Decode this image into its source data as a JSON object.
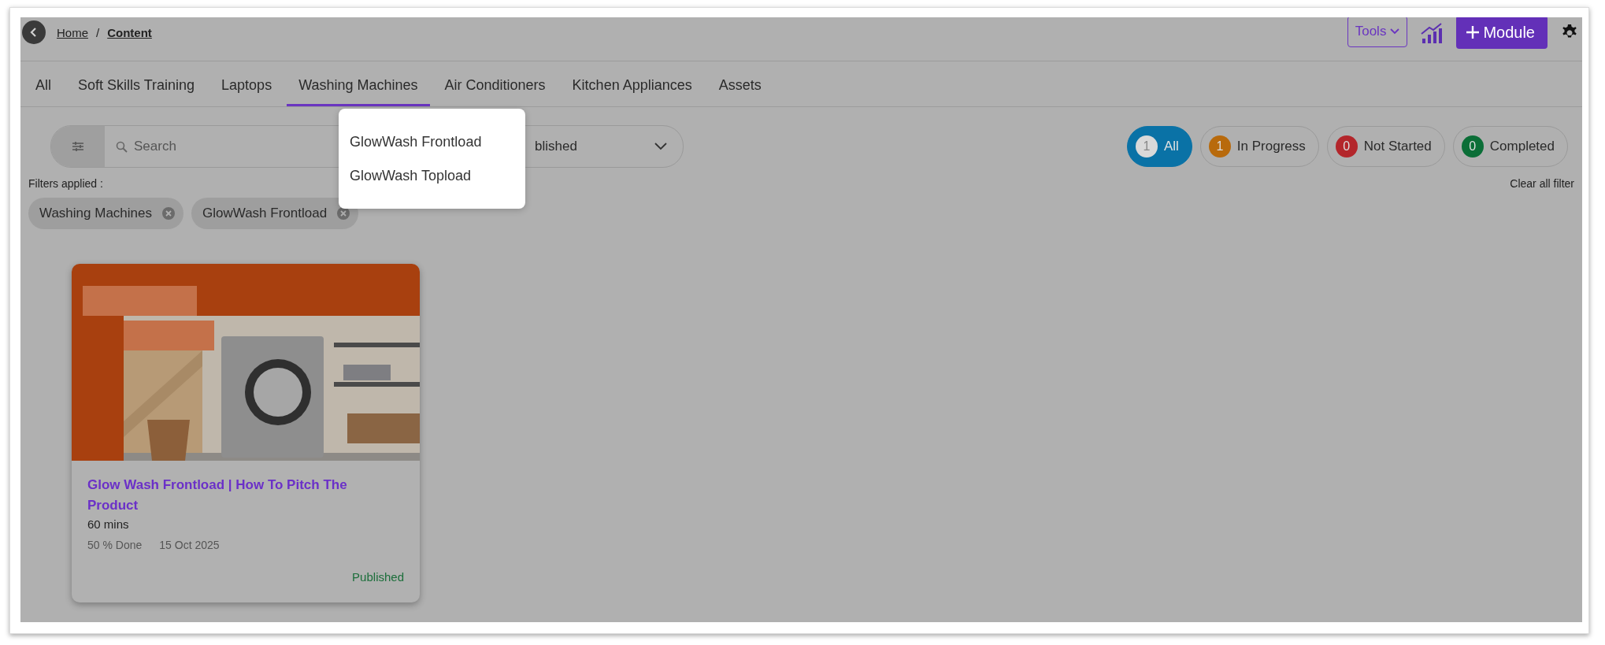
{
  "breadcrumb": {
    "items": [
      {
        "label": "Home",
        "current": false
      },
      {
        "label": "Content",
        "current": true
      }
    ],
    "separator": "/"
  },
  "toolbar": {
    "tools_label": "Tools",
    "module_label": "Module"
  },
  "tabs": [
    {
      "label": "All",
      "selected": false
    },
    {
      "label": "Soft Skills Training",
      "selected": false
    },
    {
      "label": "Laptops",
      "selected": false
    },
    {
      "label": "Washing Machines",
      "selected": true
    },
    {
      "label": "Air Conditioners",
      "selected": false
    },
    {
      "label": "Kitchen Appliances",
      "selected": false
    },
    {
      "label": "Assets",
      "selected": false
    }
  ],
  "tab_menu": {
    "items": [
      {
        "label": "GlowWash Frontload"
      },
      {
        "label": "GlowWash Topload"
      }
    ]
  },
  "search": {
    "placeholder": "Search"
  },
  "status_select": {
    "value": "blished"
  },
  "status_filters": [
    {
      "count": "1",
      "label": "All",
      "selected": true,
      "color": "#d9d9d9"
    },
    {
      "count": "1",
      "label": "In Progress",
      "selected": false,
      "color": "#b86a0c"
    },
    {
      "count": "0",
      "label": "Not Started",
      "selected": false,
      "color": "#b3262b"
    },
    {
      "count": "0",
      "label": "Completed",
      "selected": false,
      "color": "#0b6e37"
    }
  ],
  "filters_applied": {
    "label": "Filters applied :",
    "clear_label": "Clear all filter",
    "chips": [
      {
        "label": "Washing Machines"
      },
      {
        "label": "GlowWash Frontload"
      }
    ]
  },
  "cards": [
    {
      "kind": "picture",
      "title": "Glow Wash Frontload | How To Pitch The Product",
      "duration": "60 mins",
      "progress": "50 % Done",
      "date": "15 Oct 2025",
      "status": "Published"
    }
  ]
}
